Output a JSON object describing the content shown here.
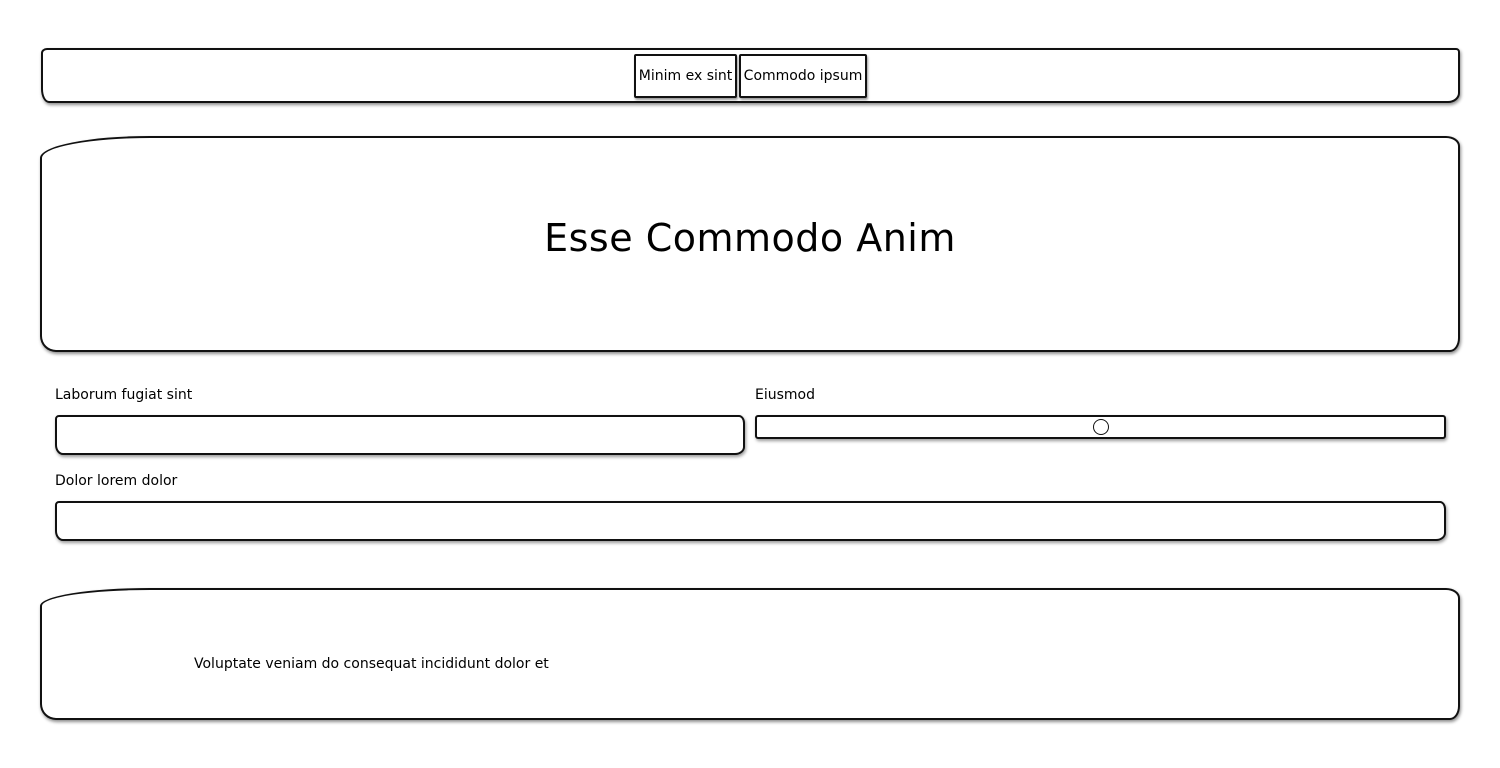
{
  "nav": {
    "items": [
      {
        "label": "Minim ex sint"
      },
      {
        "label": "Commodo ipsum"
      }
    ]
  },
  "hero": {
    "title": "Esse Commodo Anim"
  },
  "form": {
    "field_a": {
      "label": "Laborum fugiat sint",
      "value": "",
      "placeholder": ""
    },
    "slider": {
      "label": "Eiusmod",
      "value_fraction": 0.5
    },
    "field_c": {
      "label": "Dolor lorem dolor",
      "value": "",
      "placeholder": ""
    }
  },
  "footer": {
    "text": "Voluptate veniam do consequat incididunt dolor et"
  }
}
